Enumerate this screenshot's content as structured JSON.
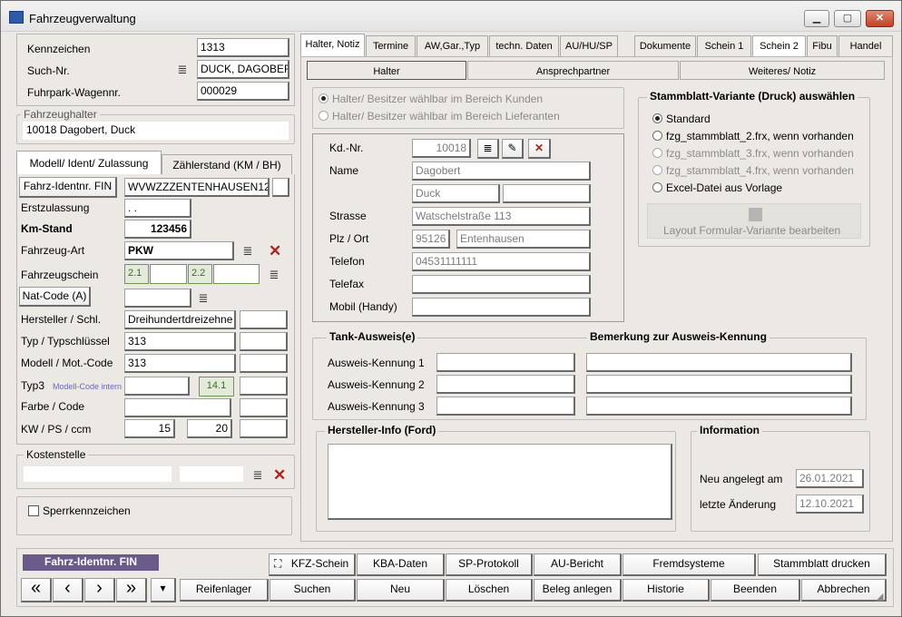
{
  "window": {
    "title": "Fahrzeugverwaltung"
  },
  "left": {
    "kennzeichen_label": "Kennzeichen",
    "kennzeichen": "1313",
    "suchnr_label": "Such-Nr.",
    "suchnr": "DUCK, DAGOBERT",
    "fuhrpark_label": "Fuhrpark-Wagennr.",
    "fuhrpark": "000029",
    "halter_group": "Fahrzeughalter",
    "halter": "10018 Dagobert, Duck",
    "tab1": "Modell/ Ident/ Zulassung",
    "tab2": "Zählerstand (KM / BH)",
    "fin_btn": "Fahrz-Identnr. FIN",
    "fin": "WVWZZZENTENHAUSEN12",
    "erstzul_label": "Erstzulassung",
    "erstzul": ". .",
    "kmstand_label": "Km-Stand",
    "kmstand": "123456",
    "fzgart_label": "Fahrzeug-Art",
    "fzgart": "PKW",
    "fzgschein_label": "Fahrzeugschein",
    "schein_21": "2.1",
    "schein_22": "2.2",
    "natcode_btn": "Nat-Code (A)",
    "hersteller_label": "Hersteller / Schl.",
    "hersteller": "Dreihundertdreizehne",
    "typ_label": "Typ / Typschlüssel",
    "typ": "313",
    "modell_label": "Modell / Mot.-Code",
    "modell": "313",
    "typ3_label": "Typ3",
    "typ3_hint": "Modell-Code intern",
    "typ3_code": "14.1",
    "farbe_label": "Farbe / Code",
    "kw_label": "KW / PS / ccm",
    "kw": "15",
    "ps": "20",
    "kosten_group": "Kostenstelle",
    "sperr_label": "Sperrkennzeichen"
  },
  "tabs": [
    "Halter, Notiz",
    "Termine",
    "AW,Gar.,Typ",
    "techn. Daten",
    "AU/HU/SP",
    "Dokumente",
    "Schein 1",
    "Schein 2",
    "Fibu",
    "Handel"
  ],
  "subtabs": [
    "Halter",
    "Ansprechpartner",
    "Weiteres/ Notiz"
  ],
  "halter": {
    "radio1": "Halter/ Besitzer wählbar im Bereich Kunden",
    "radio2": "Halter/ Besitzer wählbar im Bereich Lieferanten",
    "kdnr_label": "Kd.-Nr.",
    "kdnr": "10018",
    "name_label": "Name",
    "name1": "Dagobert",
    "name2": "Duck",
    "strasse_label": "Strasse",
    "strasse": "Watschelstraße 113",
    "plz_label": "Plz / Ort",
    "plz": "95126",
    "ort": "Entenhausen",
    "telefon_label": "Telefon",
    "telefon": "04531111111",
    "telefax_label": "Telefax",
    "mobil_label": "Mobil (Handy)"
  },
  "stammblatt": {
    "title": "Stammblatt-Variante (Druck) auswählen",
    "opt1": "Standard",
    "opt2": "fzg_stammblatt_2.frx, wenn vorhanden",
    "opt3": "fzg_stammblatt_3.frx, wenn vorhanden",
    "opt4": "fzg_stammblatt_4.frx, wenn vorhanden",
    "opt5": "Excel-Datei aus Vorlage",
    "layout_btn": "Layout Formular-Variante bearbeiten"
  },
  "tank": {
    "title": "Tank-Ausweis(e)",
    "bem_title": "Bemerkung zur Ausweis-Kennung",
    "k1": "Ausweis-Kennung 1",
    "k2": "Ausweis-Kennung 2",
    "k3": "Ausweis-Kennung 3"
  },
  "hinfo": {
    "title": "Hersteller-Info (Ford)"
  },
  "info": {
    "title": "Information",
    "neu_label": "Neu angelegt am",
    "neu": "26.01.2021",
    "aend_label": "letzte Änderung",
    "aend": "12.10.2021"
  },
  "bottom": {
    "fin_badge": "Fahrz-Identnr. FIN",
    "kfz_schein": "KFZ-Schein",
    "kba": "KBA-Daten",
    "sp": "SP-Protokoll",
    "au": "AU-Bericht",
    "fremd": "Fremdsysteme",
    "stamm": "Stammblatt drucken",
    "nav_first": "«",
    "nav_prev": "‹",
    "nav_next": "›",
    "nav_last": "»",
    "nav_menu": "▾",
    "reifen": "Reifenlager",
    "suchen": "Suchen",
    "neu": "Neu",
    "loeschen": "Löschen",
    "beleg": "Beleg anlegen",
    "historie": "Historie",
    "beenden": "Beenden",
    "abbrechen": "Abbrechen"
  },
  "colors": {
    "window_bg": "#ece9e4",
    "badge_bg": "#6a5a8a",
    "delete_red": "#b02020"
  }
}
